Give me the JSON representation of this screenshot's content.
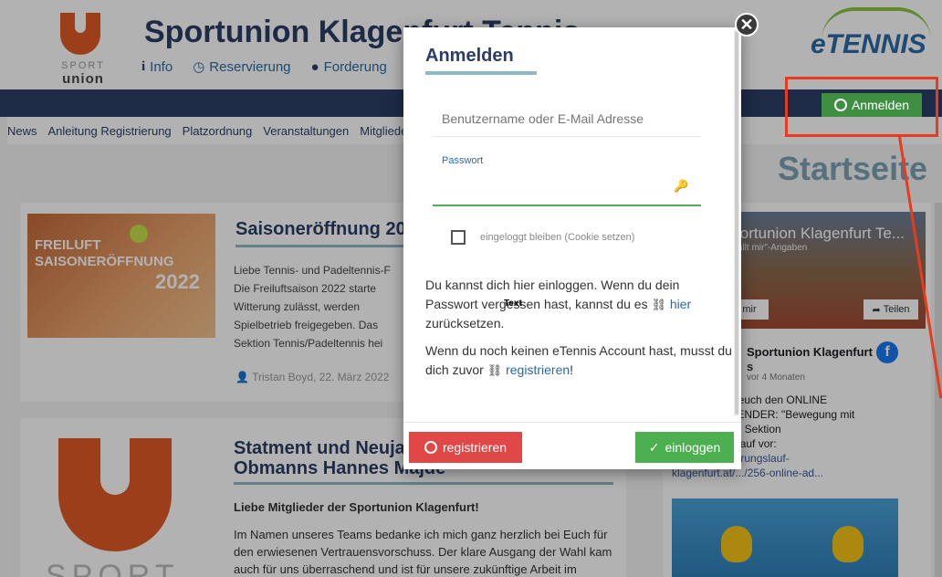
{
  "header": {
    "logo_small": "SPORT",
    "logo_name": "union",
    "site_title": "Sportunion Klagenfurt Tennis",
    "nav": [
      {
        "icon": "info-icon",
        "label": "Info"
      },
      {
        "icon": "clock-icon",
        "label": "Reservierung"
      },
      {
        "icon": "ball-icon",
        "label": "Forderung"
      }
    ],
    "brand": "eTENNIS",
    "login_label": "Anmelden"
  },
  "subnav": [
    "News",
    "Anleitung Registrierung",
    "Platzordnung",
    "Veranstaltungen",
    "Mitglieder"
  ],
  "page_heading": "Startseite",
  "post1": {
    "image_line1": "FREILUFT",
    "image_line2": "SAISONERÖFFNUNG",
    "image_year": "2022",
    "title": "Saisoneröffnung 2022",
    "lines": [
      "Liebe Tennis- und Padeltennis-F",
      "Die Freiluftsaison 2022 starte",
      "Witterung zulässt, werden",
      "Spielbetrieb freigegeben. Das",
      "Sektion Tennis/Padeltennis hei"
    ],
    "author": "Tristan Boyd, 22. März 2022"
  },
  "post2": {
    "title_line1": "Statment und Neujahr",
    "title_line2": "Obmanns Hannes Majde",
    "lead": "Liebe Mitglieder der Sportunion Klagenfurt!",
    "text": "Im Namen unseres Teams bedanke ich mich ganz herzlich bei Euch für den erwiesenen Vertrauensvorschuss. Der klare Ausgang der Wahl kam auch für uns überraschend und ist für unsere zukünftige Arbeit im",
    "logo_text": "SPORT"
  },
  "facebook": {
    "page_title": "Sportunion Klagenfurt Te...",
    "likes": "gefällt mir\"-Angaben",
    "like_btn": "mir",
    "share_btn": "Teilen",
    "name": "Sportunion Klagenfurt",
    "name_suffix": "s",
    "time": "vor 4 Monaten",
    "post_line1": "Wir laden wir euch den ONLINE",
    "post_line2": "ADVENTKALENDER: \"Bewegung mit",
    "post_line3": "Freunden\" der Sektion",
    "post_line4": "Orientierungslauf vor:",
    "post_link1": "https://orientierungslauf-",
    "post_link2": "klagenfurt.at/.../256-online-ad..."
  },
  "modal": {
    "title": "Anmelden",
    "user_placeholder": "Benutzername oder E-Mail Adresse",
    "password_label": "Passwort",
    "remember_label": "eingeloggt bleiben (Cookie setzen)",
    "info1_a": "Du kannst dich hier einloggen. Wenn du dein Passwort vergessen hast, kannst du es",
    "info1_link": "hier",
    "info1_b": "zurücksetzen.",
    "info2_a": "Wenn du noch keinen eTennis Account hast, musst du dich zuvor",
    "info2_link": "registrieren",
    "info2_b": "!",
    "cursor_label": "Text",
    "register_button": "registrieren",
    "login_button": "einloggen",
    "close": "✕"
  },
  "colors": {
    "navy": "#2c3e66",
    "accent_green": "#4caf50",
    "accent_red": "#e04848",
    "highlight_red": "#e83a1c",
    "link_blue": "#2c6aa5"
  }
}
